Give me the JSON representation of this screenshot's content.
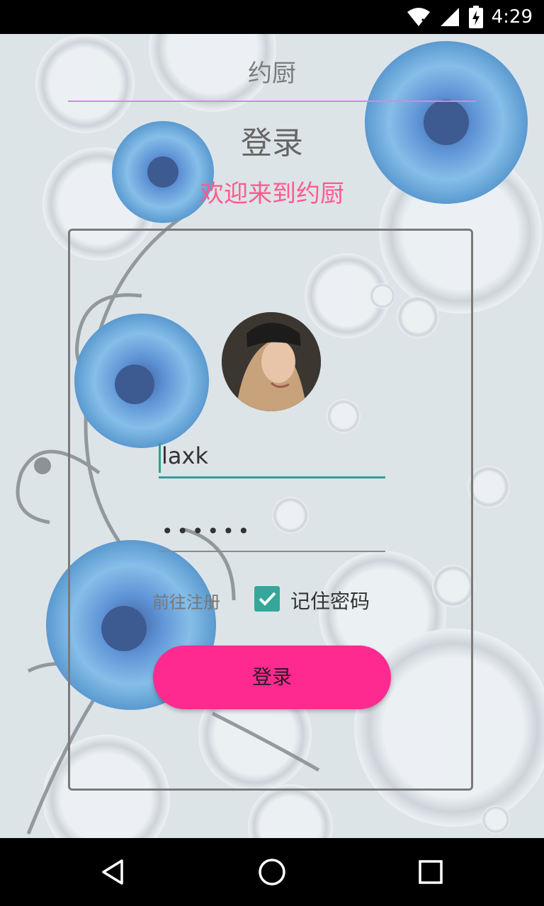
{
  "status_bar": {
    "time": "4:29",
    "icons": [
      "wifi-icon",
      "signal-icon",
      "battery-charging-icon"
    ]
  },
  "app": {
    "title": "约厨",
    "heading": "登录",
    "welcome": "欢迎来到约厨",
    "username": {
      "value": "laxk"
    },
    "password": {
      "masked_value": "••••••"
    },
    "register_label": "前往注册",
    "remember_label": "记住密码",
    "remember_checked": true,
    "login_button_label": "登录",
    "colors": {
      "accent": "#2fa094",
      "login_button": "#ff2a90",
      "welcome_text": "#ff5a8e",
      "divider": "#c98fe0"
    }
  },
  "nav_bar": {
    "buttons": [
      "back-icon",
      "home-icon",
      "recents-icon"
    ]
  }
}
